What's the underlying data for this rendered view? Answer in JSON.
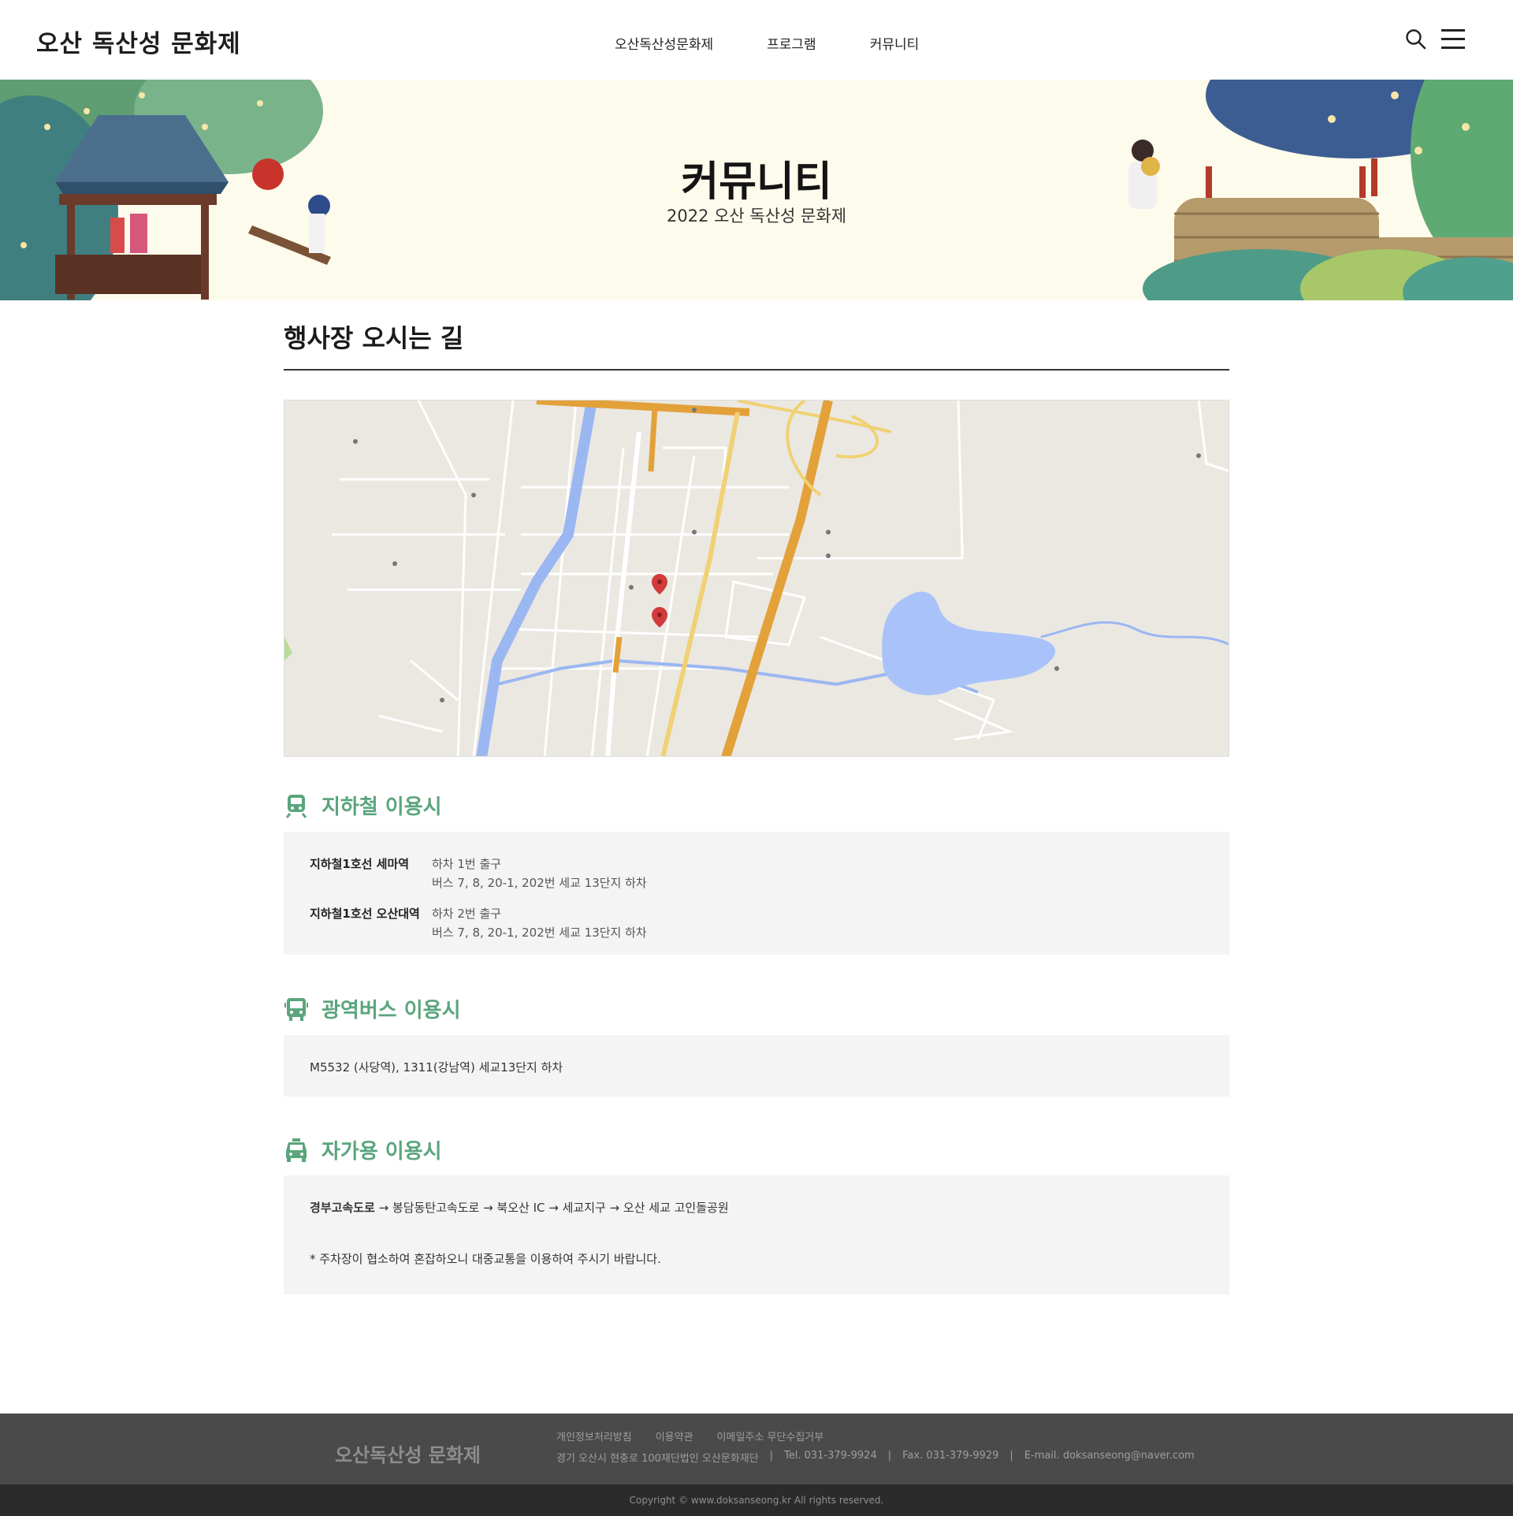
{
  "header": {
    "logo": "오산 독산성 문화제",
    "nav": [
      "오산독산성문화제",
      "프로그램",
      "커뮤니티"
    ]
  },
  "banner": {
    "title": "커뮤니티",
    "subtitle": "2022 오산 독산성 문화제"
  },
  "page_title": "행사장 오시는 길",
  "subway": {
    "title": "지하철 이용시",
    "rows": [
      {
        "station": "지하철1호선 세마역",
        "line1": "하차 1번 출구",
        "line2": "버스 7, 8, 20-1, 202번 세교 13단지 하차"
      },
      {
        "station": "지하철1호선 오산대역",
        "line1": "하차 2번 출구",
        "line2": "버스 7, 8, 20-1, 202번 세교 13단지 하차"
      }
    ]
  },
  "bus": {
    "title": "광역버스 이용시",
    "text": "M5532 (사당역), 1311(강남역) 세교13단지 하차"
  },
  "car": {
    "title": "자가용 이용시",
    "route_bold": "경부고속도로",
    "route_rest": " → 봉담동탄고속도로 → 북오산 IC → 세교지구 → 오산 세교 고인돌공원",
    "note": "* 주차장이 협소하여 혼잡하오니 대중교통을 이용하여 주시기 바랍니다."
  },
  "footer": {
    "logo": "오산독산성 문화제",
    "links": [
      "개인정보처리방침",
      "이용약관",
      "이메일주소 무단수집거부"
    ],
    "address": "경기 오산시 현충로 100재단법인 오산문화재단",
    "tel": "Tel. 031-379-9924",
    "fax": "Fax. 031-379-9929",
    "email": "E-mail. doksanseong@naver.com",
    "sep": "|",
    "copyright": "Copyright © www.doksanseong.kr All rights reserved."
  },
  "colors": {
    "accent_green": "#5aa57d",
    "footer_bg": "#4a4a4a",
    "banner_bg": "#fdfbeb"
  }
}
